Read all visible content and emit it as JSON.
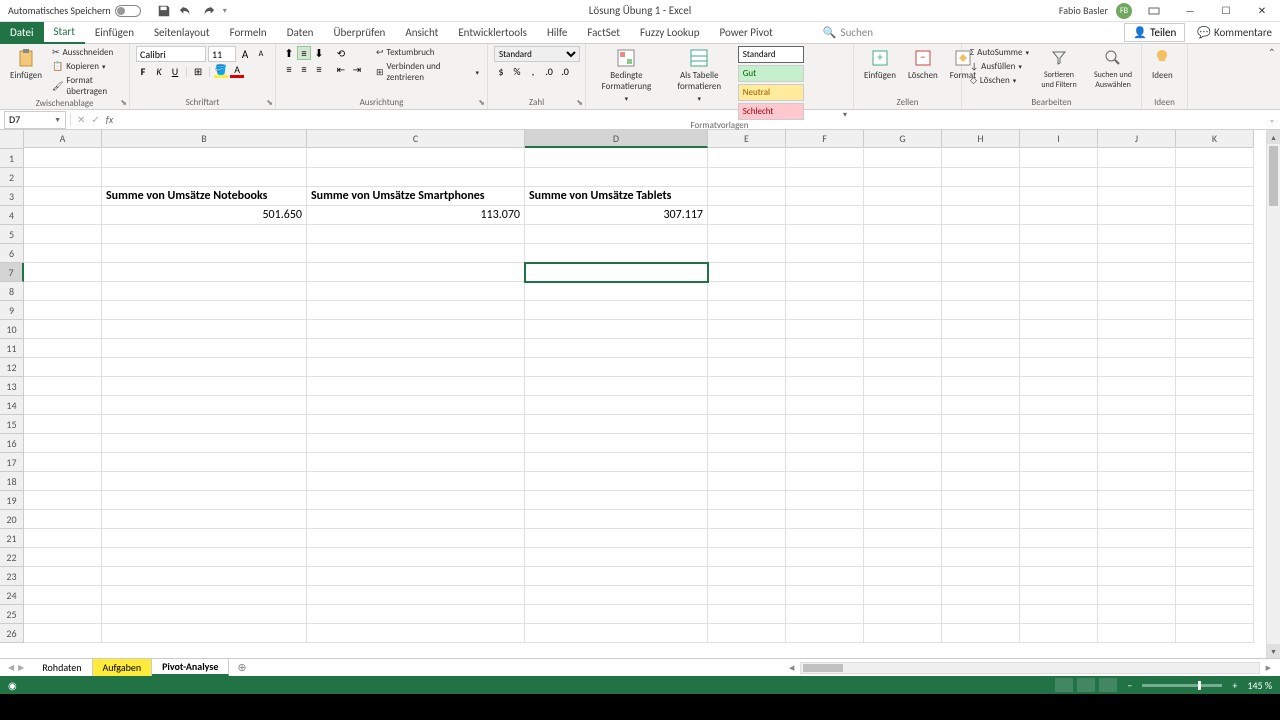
{
  "titlebar": {
    "autosave_label": "Automatisches Speichern",
    "doc_title": "Lösung Übung 1 - Excel",
    "user_name": "Fabio Basler",
    "user_initials": "FB"
  },
  "tabs": {
    "file": "Datei",
    "items": [
      "Start",
      "Einfügen",
      "Seitenlayout",
      "Formeln",
      "Daten",
      "Überprüfen",
      "Ansicht",
      "Entwicklertools",
      "Hilfe",
      "FactSet",
      "Fuzzy Lookup",
      "Power Pivot"
    ],
    "active_index": 0,
    "search_placeholder": "Suchen",
    "share": "Teilen",
    "comments": "Kommentare"
  },
  "ribbon": {
    "clipboard": {
      "paste": "Einfügen",
      "cut": "Ausschneiden",
      "copy": "Kopieren",
      "format_painter": "Format übertragen",
      "label": "Zwischenablage"
    },
    "font": {
      "name": "Calibri",
      "size": "11",
      "label": "Schriftart"
    },
    "alignment": {
      "wrap": "Textumbruch",
      "merge": "Verbinden und zentrieren",
      "label": "Ausrichtung"
    },
    "number": {
      "format": "Standard",
      "label": "Zahl"
    },
    "styles": {
      "cond_format": "Bedingte Formatierung",
      "as_table": "Als Tabelle formatieren",
      "standard": "Standard",
      "gut": "Gut",
      "neutral": "Neutral",
      "schlecht": "Schlecht",
      "label": "Formatvorlagen"
    },
    "cells": {
      "insert": "Einfügen",
      "delete": "Löschen",
      "format": "Format",
      "label": "Zellen"
    },
    "editing": {
      "autosum": "AutoSumme",
      "fill": "Ausfüllen",
      "clear": "Löschen",
      "sort": "Sortieren und Filtern",
      "find": "Suchen und Auswählen",
      "label": "Bearbeiten"
    },
    "ideas": {
      "btn": "Ideen",
      "label": "Ideen"
    }
  },
  "namebox": "D7",
  "columns": [
    "A",
    "B",
    "C",
    "D",
    "E",
    "F",
    "G",
    "H",
    "I",
    "J",
    "K"
  ],
  "selected_col": "D",
  "selected_row": 7,
  "data_cells": {
    "B3": "Summe von Umsätze Notebooks",
    "C3": "Summe von Umsätze Smartphones",
    "D3": "Summe von Umsätze Tablets",
    "B4": "501.650",
    "C4": "113.070",
    "D4": "307.117"
  },
  "sheets": {
    "items": [
      "Rohdaten",
      "Aufgaben",
      "Pivot-Analyse"
    ],
    "yellow_index": 1,
    "active_index": 2
  },
  "statusbar": {
    "zoom": "145 %"
  }
}
